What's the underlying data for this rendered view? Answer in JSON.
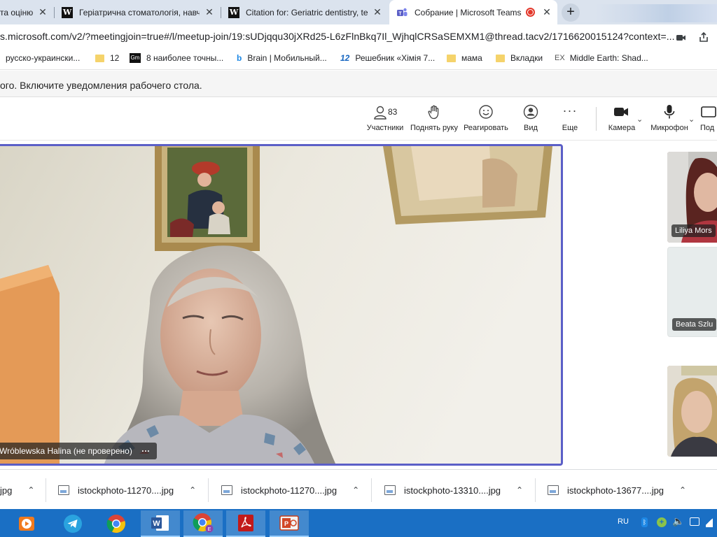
{
  "browser": {
    "tabs": [
      {
        "label": "та оціню"
      },
      {
        "label": "Геріатрична стоматологія, навча"
      },
      {
        "label": "Citation for: Geriatric dentistry, te"
      },
      {
        "label": "Собрание | Microsoft Teams"
      }
    ],
    "new_tab_label": "+",
    "url": "s.microsoft.com/v2/?meetingjoin=true#/l/meetup-join/19:sUDjqqu30jXRd25-L6zFlnBkq7Il_WjhqlCRSaSEMXM1@thread.tacv2/1716620015124?context=..."
  },
  "bookmarks": [
    {
      "label": "русско-украински..."
    },
    {
      "label": "12"
    },
    {
      "label": "8 наиболее точны..."
    },
    {
      "label": "Brain | Мобильный..."
    },
    {
      "label": "Решебник «Хімія 7..."
    },
    {
      "label": "мама"
    },
    {
      "label": "Вкладки"
    },
    {
      "label": "Middle Earth: Shad..."
    }
  ],
  "notification": {
    "text": "ого. Включите уведомления рабочего стола."
  },
  "toolbar": {
    "participants_count": "83",
    "participants_label": "Участники",
    "raise_hand_label": "Поднять руку",
    "react_label": "Реагировать",
    "view_label": "Вид",
    "more_label": "Еще",
    "camera_label": "Камера",
    "mic_label": "Микрофон",
    "share_label": "Под"
  },
  "stage": {
    "main_speaker": "Wróblewska Halina (не проверено)",
    "more_glyph": "···",
    "thumbnails": [
      {
        "name": "Liliya Mors"
      },
      {
        "name": "Beata Szlu"
      }
    ]
  },
  "downloads": [
    {
      "name": "jpg"
    },
    {
      "name": "istockphoto-11270....jpg"
    },
    {
      "name": "istockphoto-11270....jpg"
    },
    {
      "name": "istockphoto-13310....jpg"
    },
    {
      "name": "istockphoto-13677....jpg"
    }
  ],
  "taskbar": {
    "lang": "RU"
  },
  "colors": {
    "teams_accent": "#5b5fc7",
    "taskbar": "#1a6fc4",
    "tab_strip": "#dbe3ee"
  }
}
